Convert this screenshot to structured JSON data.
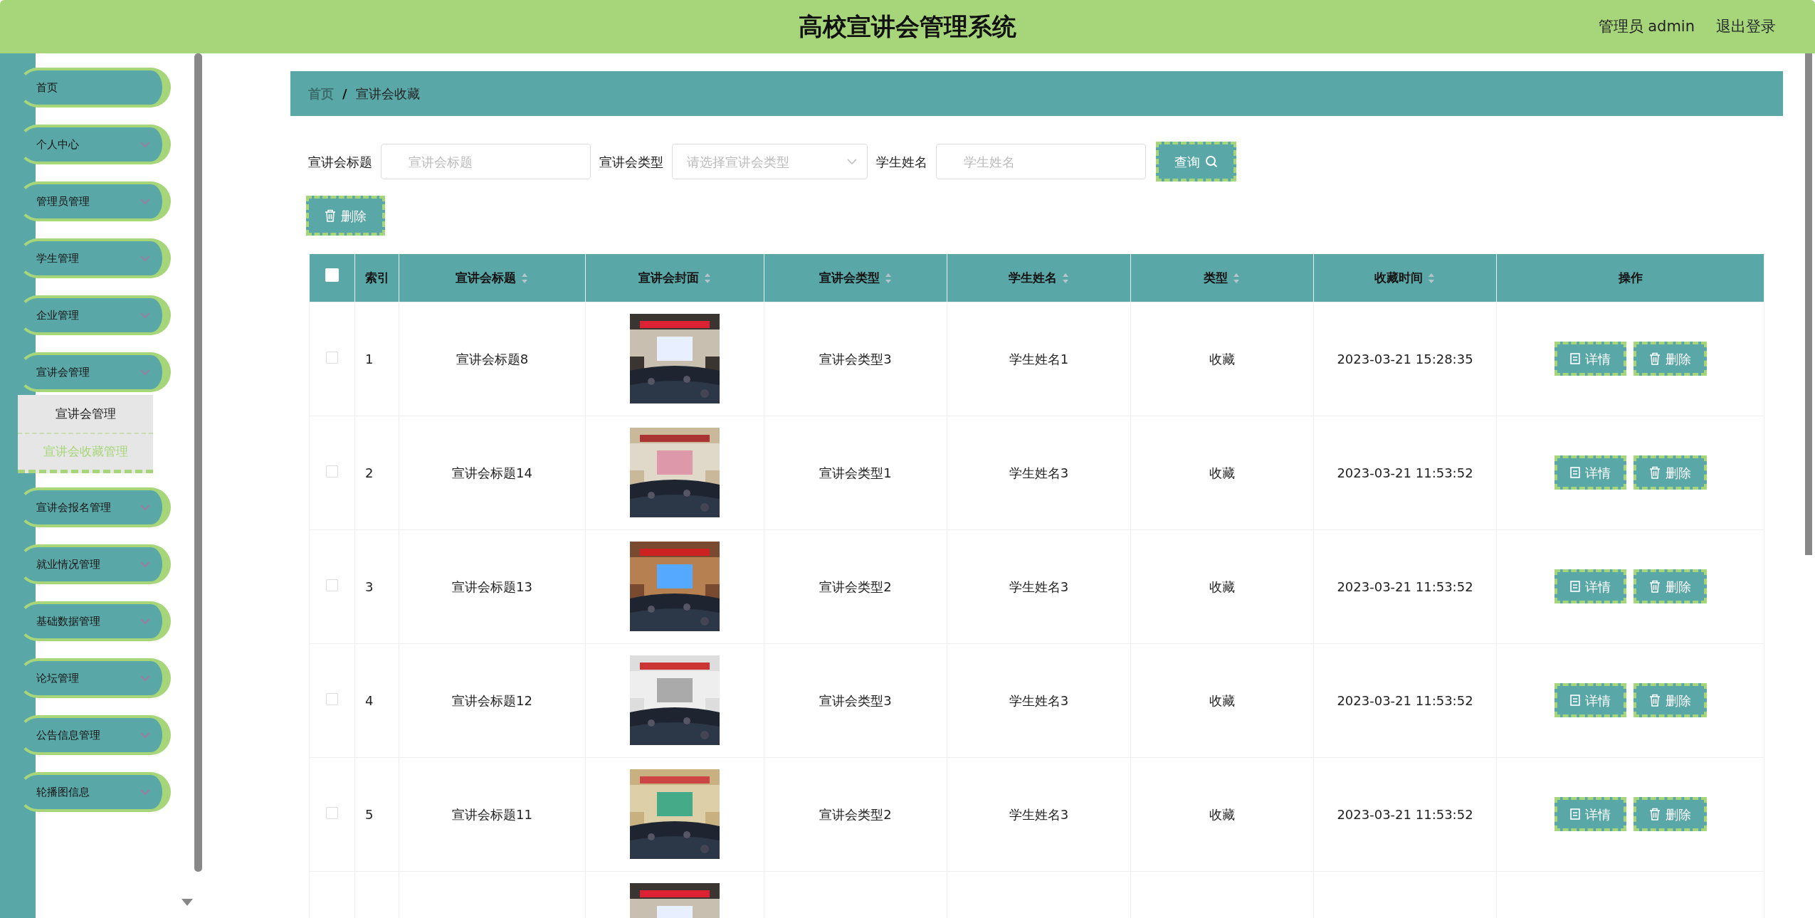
{
  "header": {
    "title": "高校宣讲会管理系统",
    "user": "管理员 admin",
    "logout": "退出登录"
  },
  "sidebar": {
    "items": [
      {
        "label": "首页",
        "has_children": false
      },
      {
        "label": "个人中心",
        "has_children": true,
        "expanded": false
      },
      {
        "label": "管理员管理",
        "has_children": true,
        "expanded": false
      },
      {
        "label": "学生管理",
        "has_children": true,
        "expanded": false
      },
      {
        "label": "企业管理",
        "has_children": true,
        "expanded": false
      },
      {
        "label": "宣讲会管理",
        "has_children": true,
        "expanded": true,
        "children": [
          {
            "label": "宣讲会管理",
            "selected": false
          },
          {
            "label": "宣讲会收藏管理",
            "selected": true
          }
        ]
      },
      {
        "label": "宣讲会报名管理",
        "has_children": true,
        "expanded": false
      },
      {
        "label": "就业情况管理",
        "has_children": true,
        "expanded": false
      },
      {
        "label": "基础数据管理",
        "has_children": true,
        "expanded": false
      },
      {
        "label": "论坛管理",
        "has_children": true,
        "expanded": false
      },
      {
        "label": "公告信息管理",
        "has_children": true,
        "expanded": false
      },
      {
        "label": "轮播图信息",
        "has_children": true,
        "expanded": false
      }
    ]
  },
  "breadcrumb": [
    "首页",
    "/",
    "宣讲会收藏"
  ],
  "filters": [
    {
      "kind": "input",
      "label": "宣讲会标题",
      "placeholder": "宣讲会标题"
    },
    {
      "kind": "select",
      "label": "宣讲会类型",
      "placeholder": "请选择宣讲会类型"
    },
    {
      "kind": "input",
      "label": "学生姓名",
      "placeholder": "学生姓名"
    }
  ],
  "search_button": "查询",
  "delete_button": "删除",
  "table": {
    "select_all_checked": false,
    "columns": [
      {
        "label": "索引",
        "sortable": false
      },
      {
        "label": "宣讲会标题",
        "sortable": true
      },
      {
        "label": "宣讲会封面",
        "sortable": true
      },
      {
        "label": "宣讲会类型",
        "sortable": true
      },
      {
        "label": "学生姓名",
        "sortable": true
      },
      {
        "label": "类型",
        "sortable": true
      },
      {
        "label": "收藏时间",
        "sortable": true
      },
      {
        "label": "操作",
        "sortable": false
      }
    ],
    "rows": [
      {
        "checked": false,
        "index": "1",
        "title": "宣讲会标题8",
        "cover": {
          "kind": "picture"
        },
        "type": "宣讲会类型3",
        "student": "学生姓名1",
        "kind": "收藏",
        "time": "2023-03-21 15:28:35",
        "actions": [
          "详情",
          "删除"
        ]
      },
      {
        "checked": false,
        "index": "2",
        "title": "宣讲会标题14",
        "cover": {
          "kind": "picture"
        },
        "type": "宣讲会类型1",
        "student": "学生姓名3",
        "kind": "收藏",
        "time": "2023-03-21 11:53:52",
        "actions": [
          "详情",
          "删除"
        ]
      },
      {
        "checked": false,
        "index": "3",
        "title": "宣讲会标题13",
        "cover": {
          "kind": "picture"
        },
        "type": "宣讲会类型2",
        "student": "学生姓名3",
        "kind": "收藏",
        "time": "2023-03-21 11:53:52",
        "actions": [
          "详情",
          "删除"
        ]
      },
      {
        "checked": false,
        "index": "4",
        "title": "宣讲会标题12",
        "cover": {
          "kind": "picture"
        },
        "type": "宣讲会类型3",
        "student": "学生姓名3",
        "kind": "收藏",
        "time": "2023-03-21 11:53:52",
        "actions": [
          "详情",
          "删除"
        ]
      },
      {
        "checked": false,
        "index": "5",
        "title": "宣讲会标题11",
        "cover": {
          "kind": "picture"
        },
        "type": "宣讲会类型2",
        "student": "学生姓名3",
        "kind": "收藏",
        "time": "2023-03-21 11:53:52",
        "actions": [
          "详情",
          "删除"
        ]
      },
      {
        "cover": {
          "kind": "picture"
        }
      }
    ]
  }
}
